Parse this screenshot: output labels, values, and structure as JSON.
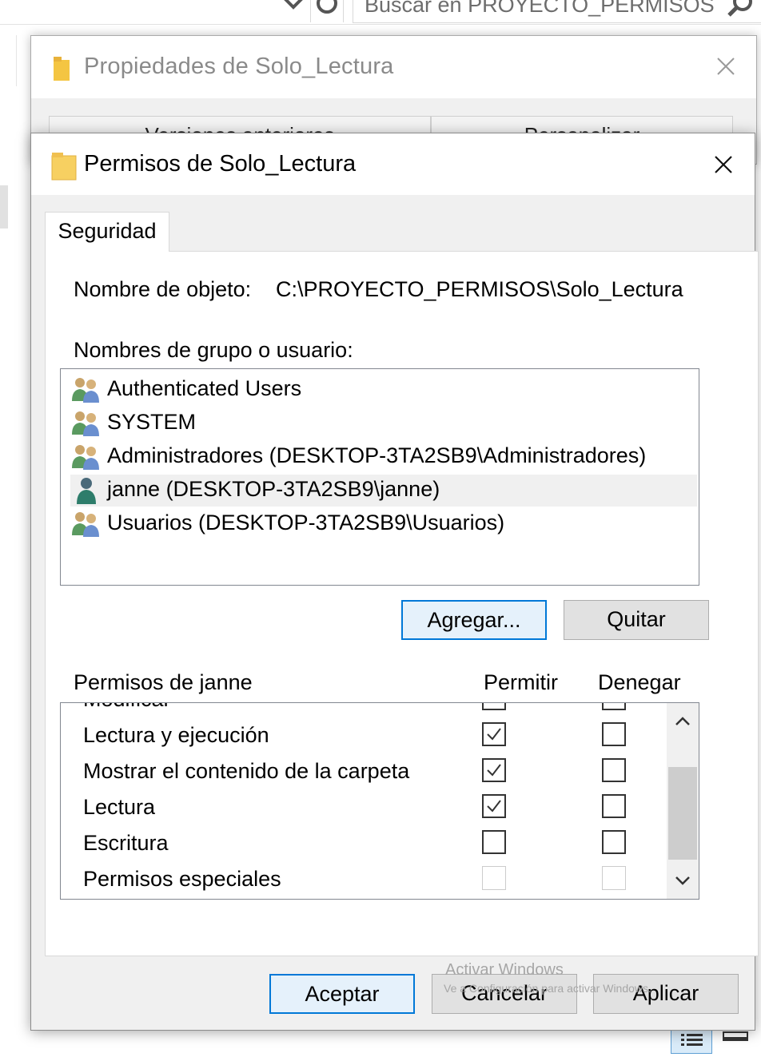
{
  "explorer": {
    "search_placeholder": "Buscar en PROYECTO_PERMISOS"
  },
  "properties_dialog": {
    "title": "Propiedades de Solo_Lectura",
    "tabs": [
      "Versiones anteriores",
      "Personalizar"
    ]
  },
  "permissions_dialog": {
    "title": "Permisos de Solo_Lectura",
    "tab": "Seguridad",
    "object_name_label": "Nombre de objeto:",
    "object_name_value": "C:\\PROYECTO_PERMISOS\\Solo_Lectura",
    "groups_label": "Nombres de grupo o usuario:",
    "users": [
      {
        "name": "Authenticated Users",
        "icon": "group-icon"
      },
      {
        "name": "SYSTEM",
        "icon": "group-icon"
      },
      {
        "name": "Administradores (DESKTOP-3TA2SB9\\Administradores)",
        "icon": "group-icon"
      },
      {
        "name": "janne (DESKTOP-3TA2SB9\\janne)",
        "icon": "user-icon",
        "selected": true
      },
      {
        "name": "Usuarios (DESKTOP-3TA2SB9\\Usuarios)",
        "icon": "group-icon"
      }
    ],
    "add_button": "Agregar...",
    "remove_button": "Quitar",
    "permissions_label": "Permisos de janne",
    "allow_header": "Permitir",
    "deny_header": "Denegar",
    "permissions": [
      {
        "name": "Modificar",
        "allow": false,
        "deny": false,
        "partial": true
      },
      {
        "name": "Lectura y ejecución",
        "allow": true,
        "deny": false
      },
      {
        "name": "Mostrar el contenido de la carpeta",
        "allow": true,
        "deny": false
      },
      {
        "name": "Lectura",
        "allow": true,
        "deny": false
      },
      {
        "name": "Escritura",
        "allow": false,
        "deny": false
      },
      {
        "name": "Permisos especiales",
        "allow": false,
        "deny": false,
        "disabled": true
      }
    ],
    "ok_button": "Aceptar",
    "cancel_button": "Cancelar",
    "apply_button": "Aplicar"
  },
  "watermark": {
    "line1": "Activar Windows",
    "line2": "Ve a Configuración para activar Windows."
  },
  "colors": {
    "accent": "#0078d7",
    "dialog_bg": "#f0f0f0",
    "selection": "#f0f0f0"
  }
}
